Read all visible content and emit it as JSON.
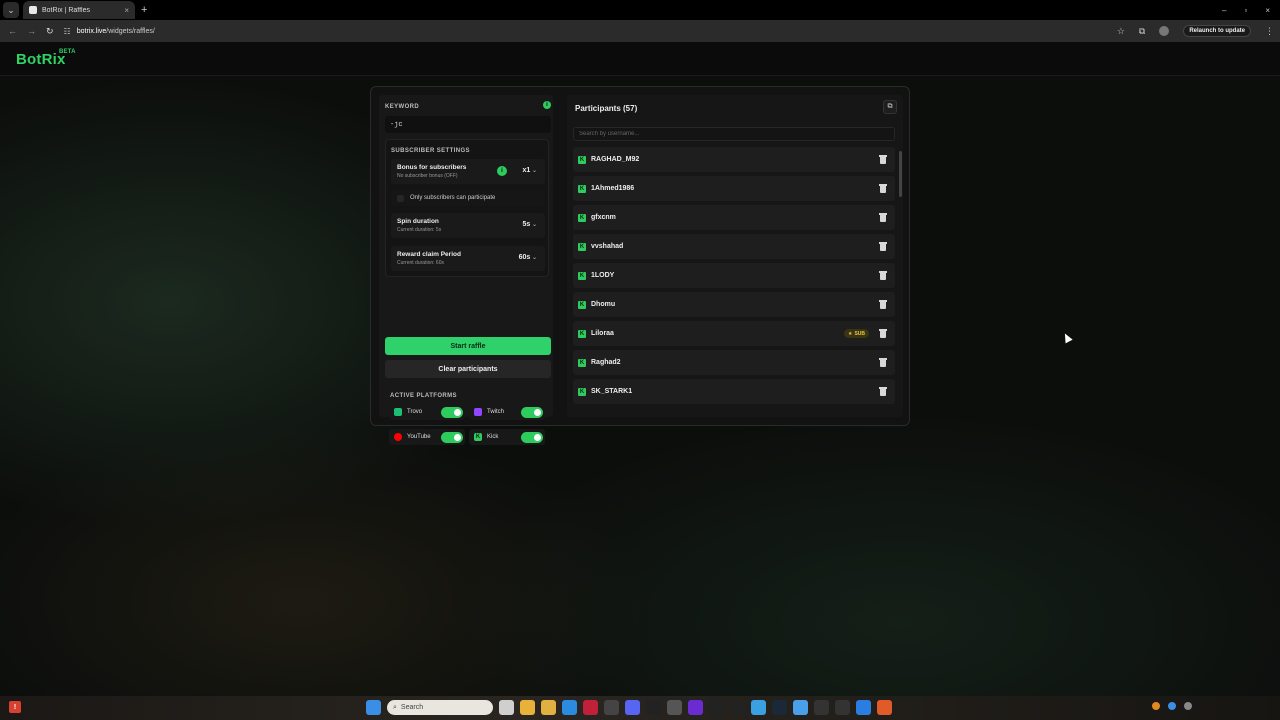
{
  "browser": {
    "tab_title": "BotRix | Raffles",
    "tab_close": "×",
    "new_tab": "+",
    "url_host": "botrix.live",
    "url_path": "/widgets/raffles/",
    "relaunch_label": "Relaunch to update",
    "window_buttons": [
      "–",
      "▫",
      "×"
    ]
  },
  "site": {
    "logo": "BotRix",
    "logo_badge": "BETA"
  },
  "keyword": {
    "label": "KEYWORD",
    "value": "-jc"
  },
  "subscriber_settings": {
    "title": "SUBSCRIBER SETTINGS",
    "bonus": {
      "title": "Bonus for subscribers",
      "subtitle": "No subscriber bonus (OFF)",
      "value": "x1"
    },
    "only_subs_label": "Only subscribers can participate",
    "spin": {
      "title": "Spin duration",
      "subtitle": "Current duration: 5s",
      "value": "5s"
    },
    "reward": {
      "title": "Reward claim Period",
      "subtitle": "Current duration: 60s",
      "value": "60s"
    }
  },
  "actions": {
    "start_label": "Start raffle",
    "clear_label": "Clear participants"
  },
  "platforms": {
    "title": "ACTIVE PLATFORMS",
    "items": [
      {
        "name": "Trovo",
        "color": "#1dbf73",
        "enabled": true
      },
      {
        "name": "Twitch",
        "color": "#9146ff",
        "enabled": true
      },
      {
        "name": "YouTube",
        "color": "#ff0000",
        "enabled": true
      },
      {
        "name": "Kick",
        "color": "#53fc18",
        "enabled": true
      }
    ]
  },
  "participants": {
    "title": "Participants (57)",
    "search_placeholder": "Search by username...",
    "sub_badge": "SUB",
    "items": [
      {
        "name": "RAGHAD_M92"
      },
      {
        "name": "1Ahmed1986"
      },
      {
        "name": "gfxcnm"
      },
      {
        "name": "vvshahad"
      },
      {
        "name": "1LODY"
      },
      {
        "name": "Dhomu"
      },
      {
        "name": "Liloraa",
        "sub": true
      },
      {
        "name": "Raghad2"
      },
      {
        "name": "SK_STARK1"
      }
    ]
  },
  "taskbar": {
    "search_placeholder": "Search"
  },
  "colors": {
    "accent": "#2ed16a",
    "background": "#0c0e0c",
    "panel": "#121212"
  }
}
